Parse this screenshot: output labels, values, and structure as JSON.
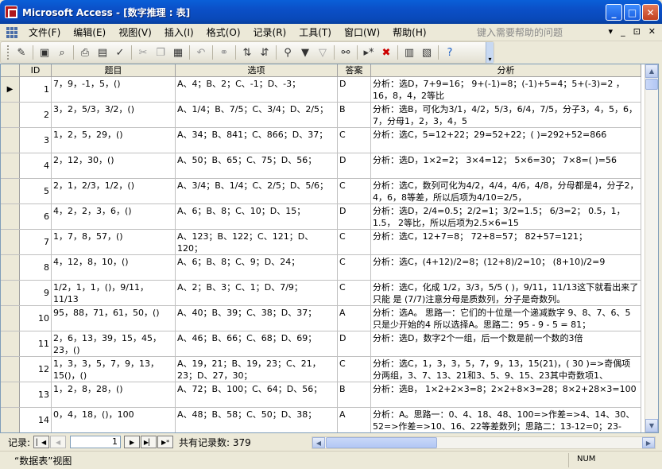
{
  "window": {
    "title": "Microsoft Access - [数字推理 : 表]",
    "minimize": "_",
    "maximize": "□",
    "close": "✕"
  },
  "menu": {
    "items": [
      "文件(F)",
      "编辑(E)",
      "视图(V)",
      "插入(I)",
      "格式(O)",
      "记录(R)",
      "工具(T)",
      "窗口(W)",
      "帮助(H)"
    ],
    "help_placeholder": "键入需要帮助的问题",
    "doc_controls": [
      "▾",
      "_",
      "⊡",
      "✕"
    ]
  },
  "toolbar": {
    "icons": [
      "design-view-icon",
      "save-icon",
      "search-file-icon",
      "print-icon",
      "print-preview-icon",
      "spelling-icon",
      "cut-icon",
      "copy-icon",
      "paste-icon",
      "undo-icon",
      "hyperlink-icon",
      "sort-ascending-icon",
      "sort-descending-icon",
      "filter-by-selection-icon",
      "filter-by-form-icon",
      "apply-filter-icon",
      "find-icon",
      "new-record-icon",
      "delete-record-icon",
      "database-window-icon",
      "new-object-icon",
      "help-icon"
    ]
  },
  "grid": {
    "columns": [
      "ID",
      "题目",
      "选项",
      "答案",
      "分析"
    ],
    "rows": [
      {
        "id": "1",
        "q": "7，9，-1，5，()",
        "o": "A、4；B、2；C、-1；D、-3；",
        "a": "D",
        "x": "分析：选D，7+9=16； 9+(-1)=8；(-1)+5=4；5+(-3)=2 ， 16，8，4，2等比"
      },
      {
        "id": "2",
        "q": "3，2，5/3，3/2，()",
        "o": "A、1/4；B、7/5；C、3/4；D、2/5；",
        "a": "B",
        "x": "分析：选B，可化为3/1，4/2，5/3，6/4，7/5，分子3，4，5，6，7，分母1，2，3，4，5"
      },
      {
        "id": "3",
        "q": "1，2，5，29，()",
        "o": "A、34；B、841；C、866；D、37；",
        "a": "C",
        "x": "分析：选C，5=12+22；29=52+22；( )=292+52=866"
      },
      {
        "id": "4",
        "q": "2，12，30，()",
        "o": "A、50；B、65；C、75；D、56；",
        "a": "D",
        "x": "分析：选D，1×2=2； 3×4=12； 5×6=30； 7×8=( )=56"
      },
      {
        "id": "5",
        "q": "2，1，2/3，1/2，()",
        "o": "A、3/4；B、1/4；C、2/5；D、5/6；",
        "a": "C",
        "x": "分析：选C，数列可化为4/2，4/4，4/6，4/8，分母都是4，分子2，4，6，8等差，所以后项为4/10=2/5，"
      },
      {
        "id": "6",
        "q": "4，2，2，3，6，()",
        "o": "A、6；B、8；C、10；D、15；",
        "a": "D",
        "x": "分析：选D，2/4=0.5；2/2=1；3/2=1.5； 6/3=2； 0.5，1，1.5， 2等比，所以后项为2.5×6=15"
      },
      {
        "id": "7",
        "q": "1，7，8，57，()",
        "o": "A、123；B、122；C、121；D、120；",
        "a": "C",
        "x": "分析：选C，12+7=8； 72+8=57； 82+57=121；"
      },
      {
        "id": "8",
        "q": "4，12，8，10，()",
        "o": "A、6；B、8；C、9；D、24；",
        "a": "C",
        "x": "分析：选C，(4+12)/2=8；(12+8)/2=10； (8+10)/2=9"
      },
      {
        "id": "9",
        "q": "1/2，1，1，()，9/11，11/13",
        "o": "A、2；B、3；C、1；D、7/9；",
        "a": "C",
        "x": "分析：选C，化成 1/2，3/3，5/5 ( )，9/11，11/13这下就看出来了只能 是 (7/7)注意分母是质数列，分子是奇数列。"
      },
      {
        "id": "10",
        "q": "95，88，71，61，50，()",
        "o": "A、40；B、39；C、38；D、37；",
        "a": "A",
        "x": "分析：选A。 思路一：它们的十位是一个递减数字 9、8、7、6、5 只是少开始的4 所以选择A。思路二：95 - 9 - 5 = 81；"
      },
      {
        "id": "11",
        "q": "2，6，13，39，15，45，23，()",
        "o": "A、46；B、66；C、68；D、69；",
        "a": "D",
        "x": "分析：选D，数字2个一组，后一个数是前一个数的3倍"
      },
      {
        "id": "12",
        "q": "1，3，3，5，7，9，13，15()，()",
        "o": "A、19，21；B、19，23；C、21，23；D、27，30；",
        "a": "C",
        "x": "分析：选C，1，3，3，5，7，9，13，15(21)，( 30 )=>奇偶项分两组，3、7、13、21和3、5、9、15、23其中奇数项1、"
      },
      {
        "id": "13",
        "q": "1，2，8，28，()",
        "o": "A、72；B、100；C、64；D、56；",
        "a": "B",
        "x": "分析：选B， 1×2+2×3=8；2×2+8×3=28；8×2+28×3=100"
      },
      {
        "id": "14",
        "q": "0，4，18，()，100",
        "o": "A、48；B、58；C、50；D、38；",
        "a": "A",
        "x": "分析：A。思路一：0、4、18、48、100=>作差=>4、14、30、52=>作差=>10、16、22等差数列；思路二：13-12=0；23-"
      }
    ]
  },
  "nav": {
    "label": "记录:",
    "current": "1",
    "total": "共有记录数: 379"
  },
  "status": {
    "text": "“数据表”视图",
    "num": "NUM"
  }
}
